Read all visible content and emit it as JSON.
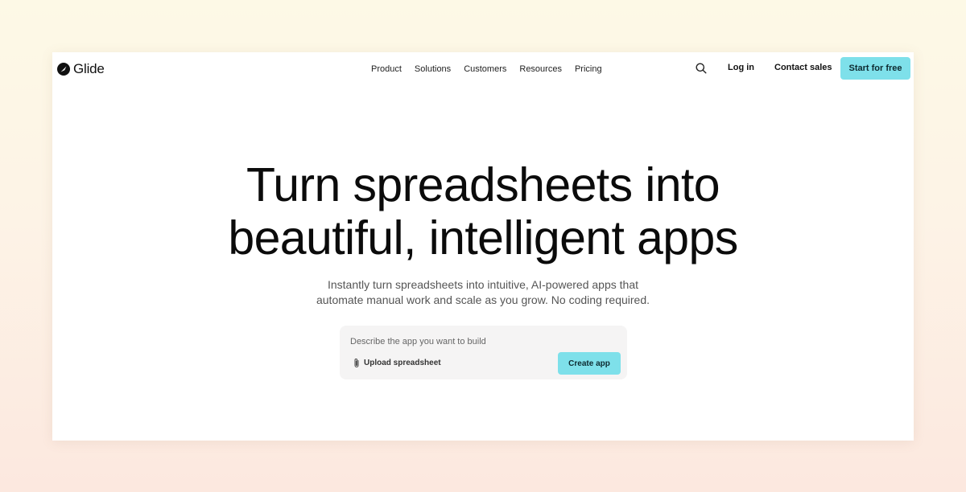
{
  "header": {
    "logo_text": "Glide",
    "nav": [
      "Product",
      "Solutions",
      "Customers",
      "Resources",
      "Pricing"
    ],
    "search_icon": "search-icon",
    "login_label": "Log in",
    "contact_label": "Contact sales",
    "start_label": "Start for free"
  },
  "hero": {
    "title_line1": "Turn spreadsheets into",
    "title_line2": "beautiful, intelligent apps",
    "subtitle_line1": "Instantly turn spreadsheets into intuitive, AI-powered apps that",
    "subtitle_line2": "automate manual work and scale as you grow. No coding required."
  },
  "prompt": {
    "placeholder": "Describe the app you want to build",
    "upload_icon": "paperclip-icon",
    "upload_label": "Upload spreadsheet",
    "create_label": "Create app"
  },
  "colors": {
    "accent": "#7ee0ea",
    "text": "#0b0b0b"
  }
}
